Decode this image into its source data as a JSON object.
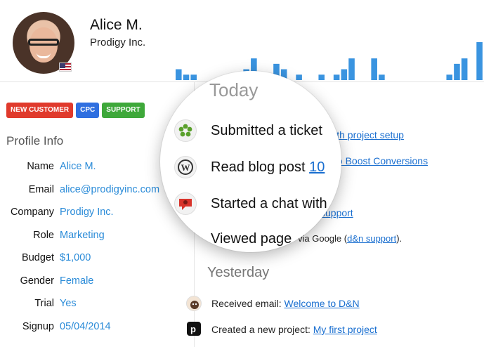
{
  "profile": {
    "name": "Alice M.",
    "company": "Prodigy Inc.",
    "tags": [
      "NEW CUSTOMER",
      "CPC",
      "SUPPORT"
    ],
    "section_title": "Profile Info",
    "fields": [
      {
        "key": "Name",
        "value": "Alice M."
      },
      {
        "key": "Email",
        "value": "alice@prodigyinc.com"
      },
      {
        "key": "Company",
        "value": "Prodigy Inc."
      },
      {
        "key": "Role",
        "value": "Marketing"
      },
      {
        "key": "Budget",
        "value": "$1,000"
      },
      {
        "key": "Gender",
        "value": "Female"
      },
      {
        "key": "Trial",
        "value": "Yes"
      },
      {
        "key": "Signup",
        "value": "05/04/2014"
      }
    ]
  },
  "activity_chart": {
    "color": "#3a94e0",
    "values": [
      2,
      1,
      1,
      0,
      0,
      0,
      0,
      0,
      0,
      2,
      4,
      0,
      1,
      3,
      2,
      0,
      1,
      0,
      0,
      1,
      0,
      1,
      2,
      4,
      0,
      0,
      4,
      1,
      0,
      0,
      0,
      0,
      0,
      0,
      0,
      0,
      1,
      3,
      4,
      0,
      7
    ]
  },
  "feed": {
    "today_label": "Today",
    "yesterday_label": "Yesterday",
    "items_behind_lens": {
      "ticket_link": "with project setup",
      "blog_link": "to Boost Conversions",
      "chat_link": "support",
      "pageview_prefix": "via Google (",
      "pageview_link": "d&n support",
      "pageview_suffix": ")."
    },
    "yesterday_items": [
      {
        "text": "Received email: ",
        "link": "Welcome to D&N",
        "icon": "mailchimp-icon"
      },
      {
        "text": "Created a new project: ",
        "link": "My first project",
        "icon": "pinterest-icon"
      }
    ]
  },
  "lens": {
    "today_label": "Today",
    "rows": [
      {
        "text": "Submitted a ticket",
        "link": "",
        "icon": "zendesk-icon"
      },
      {
        "text": "Read blog post ",
        "link": "10",
        "icon": "wordpress-icon"
      },
      {
        "text": "Started a chat with",
        "link": "",
        "icon": "chat-icon"
      },
      {
        "text": "Viewed page",
        "link": "",
        "icon": "page-icon"
      }
    ]
  }
}
